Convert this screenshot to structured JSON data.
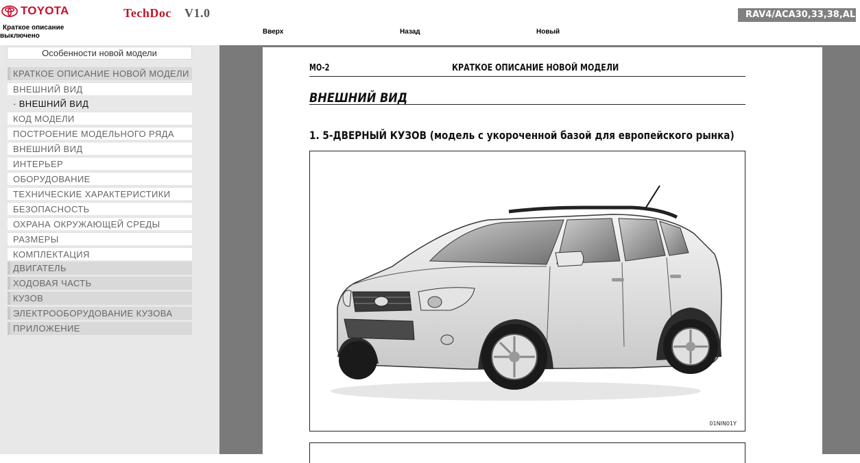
{
  "header": {
    "logo_text": "TOYOTA",
    "app_title": "TechDoc",
    "app_version": "V1.0",
    "status_line1": "Краткое описание",
    "status_line2": "выключено",
    "nav_up": "Вверх",
    "nav_back": "Назад",
    "nav_new": "Новый",
    "model": "RAV4/ACA30,33,38,AL"
  },
  "sidebar": {
    "header": "Особенности новой модели",
    "items": [
      {
        "label": "КРАТКОЕ ОПИСАНИЕ НОВОЙ МОДЕЛИ",
        "kind": "category"
      },
      {
        "label": "ВНЕШНИЙ ВИД",
        "kind": "sub"
      },
      {
        "label": "· ВНЕШНИЙ ВИД",
        "kind": "active"
      },
      {
        "label": "КОД МОДЕЛИ",
        "kind": "sub"
      },
      {
        "label": "ПОСТРОЕНИЕ МОДЕЛЬНОГО РЯДА",
        "kind": "sub"
      },
      {
        "label": "ВНЕШНИЙ ВИД",
        "kind": "sub"
      },
      {
        "label": "ИНТЕРЬЕР",
        "kind": "sub"
      },
      {
        "label": "ОБОРУДОВАНИЕ",
        "kind": "sub"
      },
      {
        "label": "ТЕХНИЧЕСКИЕ ХАРАКТЕРИСТИКИ",
        "kind": "sub"
      },
      {
        "label": "БЕЗОПАСНОСТЬ",
        "kind": "sub"
      },
      {
        "label": "ОХРАНА ОКРУЖАЮЩЕЙ СРЕДЫ",
        "kind": "sub"
      },
      {
        "label": "РАЗМЕРЫ",
        "kind": "sub"
      },
      {
        "label": "КОМПЛЕКТАЦИЯ",
        "kind": "sub"
      },
      {
        "label": "ДВИГАТЕЛЬ",
        "kind": "category"
      },
      {
        "label": "ХОДОВАЯ ЧАСТЬ",
        "kind": "category"
      },
      {
        "label": "КУЗОВ",
        "kind": "category"
      },
      {
        "label": "ЭЛЕКТРООБОРУДОВАНИЕ КУЗОВА",
        "kind": "category"
      },
      {
        "label": "ПРИЛОЖЕНИЕ",
        "kind": "category"
      }
    ]
  },
  "document": {
    "page_code": "MO-2",
    "header_title": "КРАТКОЕ ОПИСАНИЕ НОВОЙ МОДЕЛИ",
    "section_title": "ВНЕШНИЙ ВИД",
    "subsection_title": "1. 5-ДВЕРНЫЙ КУЗОВ (модель с укороченной базой для европейского рынка)",
    "figure_code": "01NIN01Y",
    "figure_icon": "car-illustration-icon"
  },
  "colors": {
    "brand_red": "#c8102e",
    "title_red": "#b8182b",
    "sidebar_bg": "#e8e8e8",
    "doc_bg": "#7a7a7a",
    "badge_bg": "#808080"
  }
}
